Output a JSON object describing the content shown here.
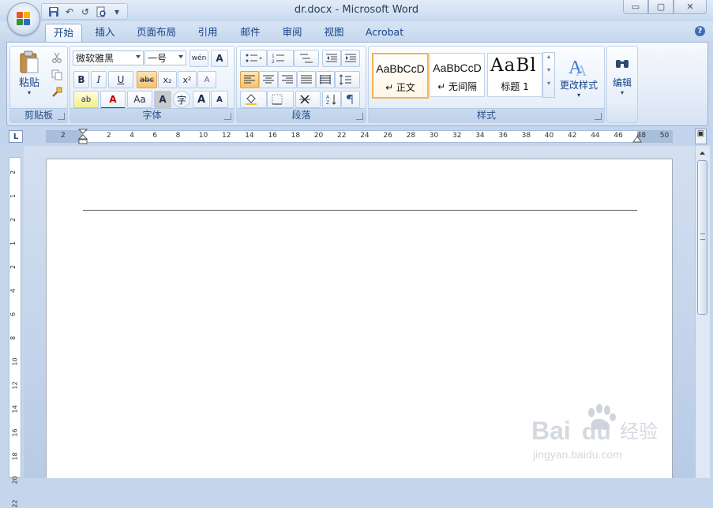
{
  "window": {
    "title": "dr.docx - Microsoft Word",
    "controls": {
      "minimize": "▭",
      "maximize": "▢",
      "close": "✕"
    }
  },
  "quick_access": {
    "icons": [
      "save-icon",
      "undo-icon",
      "redo-icon",
      "print-preview-icon",
      "customize-icon"
    ],
    "undo_glyph": "↶",
    "redo_glyph": "↺",
    "customize_glyph": "▾"
  },
  "tabs": [
    {
      "label": "开始",
      "active": true
    },
    {
      "label": "插入"
    },
    {
      "label": "页面布局"
    },
    {
      "label": "引用"
    },
    {
      "label": "邮件"
    },
    {
      "label": "审阅"
    },
    {
      "label": "视图"
    },
    {
      "label": "Acrobat"
    }
  ],
  "help_glyph": "?",
  "ribbon": {
    "clipboard": {
      "label": "剪贴板",
      "paste": "粘贴"
    },
    "font": {
      "label": "字体",
      "font_name": "微软雅黑",
      "font_size": "一号",
      "phonetic": "wén",
      "char_border": "A",
      "bold": "B",
      "italic": "I",
      "underline": "U",
      "strike": "abc",
      "subscript": "x₂",
      "superscript": "x²",
      "clear_format": "A",
      "highlight": "ab",
      "font_color": "A",
      "case": "Aa",
      "char_shading": "A",
      "enclosed": "字",
      "grow": "A",
      "shrink": "A"
    },
    "paragraph": {
      "label": "段落"
    },
    "styles": {
      "label": "样式",
      "cards": [
        {
          "sample": "AaBbCcD",
          "name": "↵ 正文",
          "selected": true
        },
        {
          "sample": "AaBbCcD",
          "name": "↵ 无间隔"
        },
        {
          "sample": "AaBl",
          "name": "标题 1"
        }
      ],
      "change_styles": "更改样式"
    },
    "editing": {
      "label": "编辑"
    }
  },
  "ruler": {
    "tab_selector": "L",
    "marks": [
      "2",
      "2",
      "4",
      "6",
      "8",
      "10",
      "12",
      "14",
      "16",
      "18",
      "20",
      "22",
      "24",
      "26",
      "28",
      "30",
      "32",
      "34",
      "36",
      "38",
      "40",
      "42",
      "44",
      "46",
      "48",
      "50"
    ],
    "vmarks": [
      "2",
      "1",
      "2",
      "1",
      "2",
      "4",
      "6",
      "8",
      "10",
      "12",
      "14",
      "16",
      "18",
      "20",
      "22"
    ]
  },
  "accent": {
    "brand": "#15428b",
    "ribbon": "#dbe6f5"
  }
}
